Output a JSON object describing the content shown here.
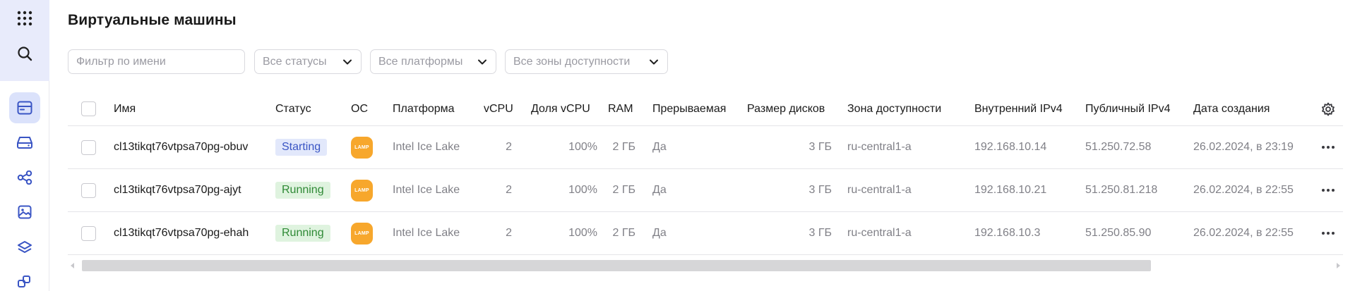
{
  "page": {
    "title": "Виртуальные машины"
  },
  "filters": {
    "name_placeholder": "Фильтр по имени",
    "status": "Все статусы",
    "platform": "Все платформы",
    "zone": "Все зоны доступности"
  },
  "table": {
    "columns": {
      "name": "Имя",
      "status": "Статус",
      "os": "ОС",
      "platform": "Платформа",
      "vcpu": "vCPU",
      "vcpu_share": "Доля vCPU",
      "ram": "RAM",
      "preemptible": "Прерываемая",
      "disk_size": "Размер дисков",
      "zone": "Зона доступности",
      "internal_ip": "Внутренний IPv4",
      "public_ip": "Публичный IPv4",
      "created": "Дата создания"
    },
    "rows": [
      {
        "name": "cl13tikqt76vtpsa70pg-obuv",
        "status": "Starting",
        "os_icon_label": "LAMP",
        "platform": "Intel Ice Lake",
        "vcpu": "2",
        "vcpu_share": "100%",
        "ram": "2 ГБ",
        "preemptible": "Да",
        "disk_size": "3 ГБ",
        "zone": "ru-central1-a",
        "internal_ip": "192.168.10.14",
        "public_ip": "51.250.72.58",
        "created": "26.02.2024, в 23:19"
      },
      {
        "name": "cl13tikqt76vtpsa70pg-ajyt",
        "status": "Running",
        "os_icon_label": "LAMP",
        "platform": "Intel Ice Lake",
        "vcpu": "2",
        "vcpu_share": "100%",
        "ram": "2 ГБ",
        "preemptible": "Да",
        "disk_size": "3 ГБ",
        "zone": "ru-central1-a",
        "internal_ip": "192.168.10.21",
        "public_ip": "51.250.81.218",
        "created": "26.02.2024, в 22:55"
      },
      {
        "name": "cl13tikqt76vtpsa70pg-ehah",
        "status": "Running",
        "os_icon_label": "LAMP",
        "platform": "Intel Ice Lake",
        "vcpu": "2",
        "vcpu_share": "100%",
        "ram": "2 ГБ",
        "preemptible": "Да",
        "disk_size": "3 ГБ",
        "zone": "ru-central1-a",
        "internal_ip": "192.168.10.3",
        "public_ip": "51.250.85.90",
        "created": "26.02.2024, в 22:55"
      }
    ]
  },
  "icons": {
    "rail": [
      "apps-grid-icon",
      "search-icon",
      "compute-icon",
      "disk-icon",
      "network-icon",
      "image-icon",
      "layers-icon",
      "cubes-icon"
    ],
    "os": "lamp-icon",
    "settings": "gear-icon",
    "row_menu": "more-icon"
  },
  "colors": {
    "accent": "#3a55c4",
    "starting_bg": "#e2e8fb",
    "running_bg": "#dff3df",
    "running_text": "#2f8a36",
    "os_icon": "#f7a72c"
  }
}
